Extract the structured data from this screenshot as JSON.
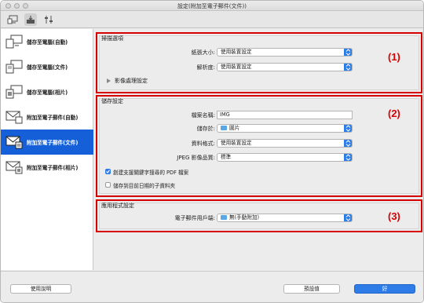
{
  "window": {
    "title": "設定(附加至電子郵件(文件))"
  },
  "toolbar": {
    "tabs": [
      {
        "icon": "scan-to-computer-tab-icon"
      },
      {
        "icon": "scan-from-panel-tab-icon"
      },
      {
        "icon": "general-settings-tab-icon"
      }
    ]
  },
  "sidebar": {
    "items": [
      {
        "label": "儲存至電腦(自動)",
        "icon": "computer-save-icon"
      },
      {
        "label": "儲存至電腦(文件)",
        "icon": "computer-document-icon"
      },
      {
        "label": "儲存至電腦(相片)",
        "icon": "computer-photo-icon"
      },
      {
        "label": "附加至電子郵件(自動)",
        "icon": "email-auto-icon"
      },
      {
        "label": "附加至電子郵件(文件)",
        "icon": "email-document-icon"
      },
      {
        "label": "附加至電子郵件(相片)",
        "icon": "email-photo-icon"
      }
    ]
  },
  "scan_options": {
    "title": "掃描選項",
    "paper_size_label": "紙張大小:",
    "paper_size_value": "使用裝置設定",
    "resolution_label": "解析度:",
    "resolution_value": "使用裝置設定",
    "image_processing_label": "影像處理設定",
    "callout": "(1)"
  },
  "save_settings": {
    "title": "儲存設定",
    "file_name_label": "檔案名稱:",
    "file_name_value": "IMG",
    "save_in_label": "儲存於:",
    "save_in_value": "圖片",
    "data_format_label": "資料格式:",
    "data_format_value": "使用裝置設定",
    "jpeg_quality_label": "JPEG 影像品質:",
    "jpeg_quality_value": "標準",
    "checkbox_pdf_label": "創建支援關鍵字搜尋的 PDF 檔案",
    "checkbox_pdf_checked": true,
    "checkbox_subfolder_label": "儲存到目前日期的子資料夾",
    "checkbox_subfolder_checked": false,
    "callout": "(2)"
  },
  "app_settings": {
    "title": "應用程式設定",
    "email_client_label": "電子郵件用戶端:",
    "email_client_value": "無(手動附加)",
    "callout": "(3)"
  },
  "buttons": {
    "help": "使用說明",
    "defaults": "預設值",
    "ok": "好"
  },
  "colors": {
    "accent": "#2d7ce8",
    "selection": "#1560d8",
    "callout": "#d70000"
  }
}
